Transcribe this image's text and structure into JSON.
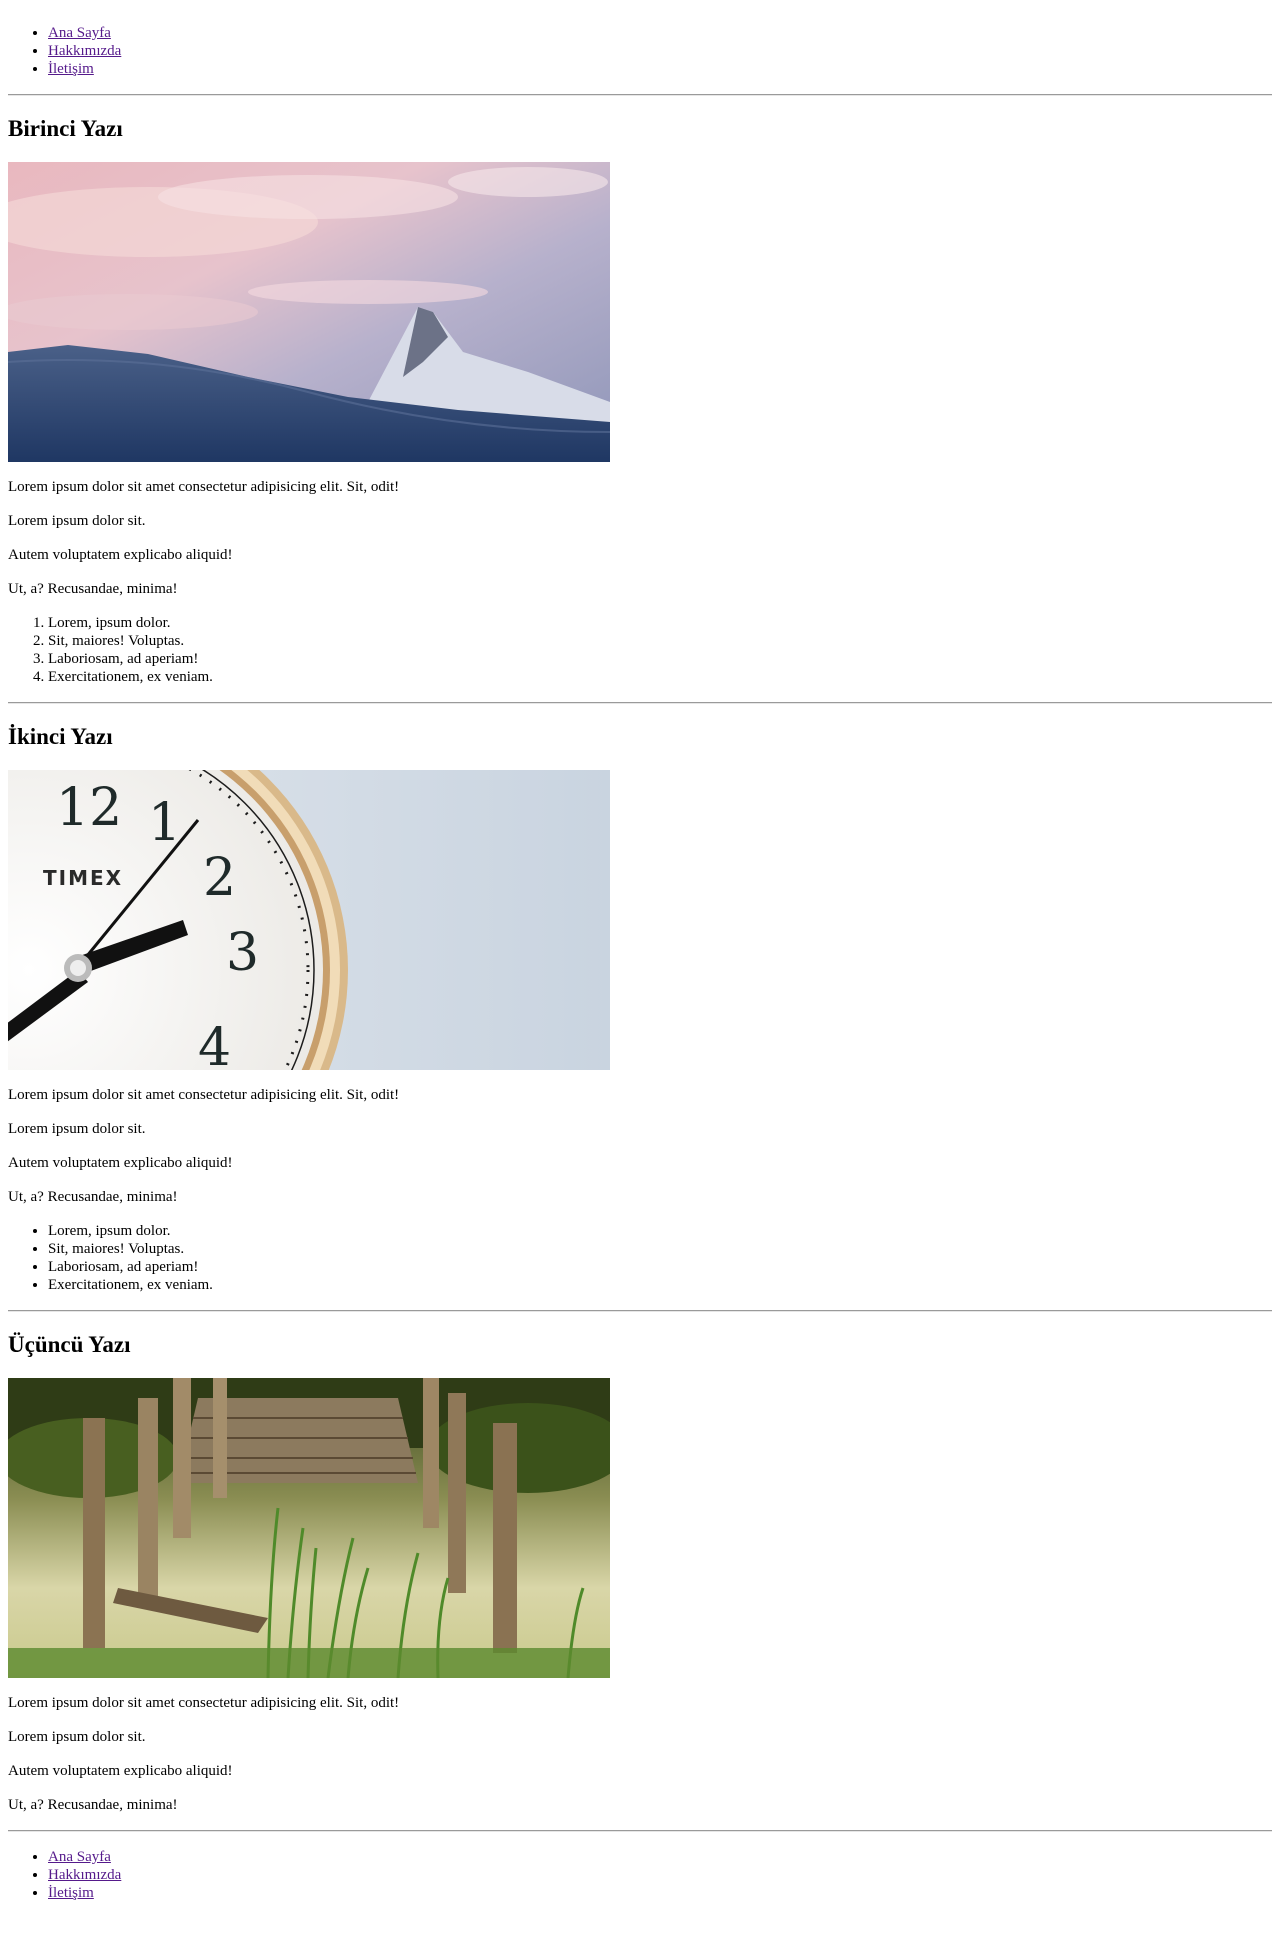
{
  "nav": {
    "items": [
      {
        "label": "Ana Sayfa"
      },
      {
        "label": "Hakkımızda"
      },
      {
        "label": "İletişim"
      }
    ]
  },
  "posts": [
    {
      "title": "Birinci Yazı",
      "image": "mountain-sunset-photo",
      "paragraphs": [
        "Lorem ipsum dolor sit amet consectetur adipisicing elit. Sit, odit!",
        "Lorem ipsum dolor sit.",
        "Autem voluptatem explicabo aliquid!",
        "Ut, a? Recusandae, minima!"
      ],
      "list_items": [
        "Lorem, ipsum dolor.",
        "Sit, maiores! Voluptas.",
        "Laboriosam, ad aperiam!",
        "Exercitationem, ex veniam."
      ]
    },
    {
      "title": "İkinci Yazı",
      "image": "timex-clock-photo",
      "image_text": [
        "12",
        "1",
        "2",
        "3",
        "4",
        "TIMEX"
      ],
      "paragraphs": [
        "Lorem ipsum dolor sit amet consectetur adipisicing elit. Sit, odit!",
        "Lorem ipsum dolor sit.",
        "Autem voluptatem explicabo aliquid!",
        "Ut, a? Recusandae, minima!"
      ],
      "list_items": [
        "Lorem, ipsum dolor.",
        "Sit, maiores! Voluptas.",
        "Laboriosam, ad aperiam!",
        "Exercitationem, ex veniam."
      ]
    },
    {
      "title": "Üçüncü Yazı",
      "image": "old-wooden-pier-photo",
      "paragraphs": [
        "Lorem ipsum dolor sit amet consectetur adipisicing elit. Sit, odit!",
        "Lorem ipsum dolor sit.",
        "Autem voluptatem explicabo aliquid!",
        "Ut, a? Recusandae, minima!"
      ]
    }
  ],
  "footer_nav": {
    "items": [
      {
        "label": "Ana Sayfa"
      },
      {
        "label": "Hakkımızda"
      },
      {
        "label": "İletişim"
      }
    ]
  },
  "colors": {
    "link_visited": "#551a8b",
    "rule": "#9a9a9a"
  }
}
